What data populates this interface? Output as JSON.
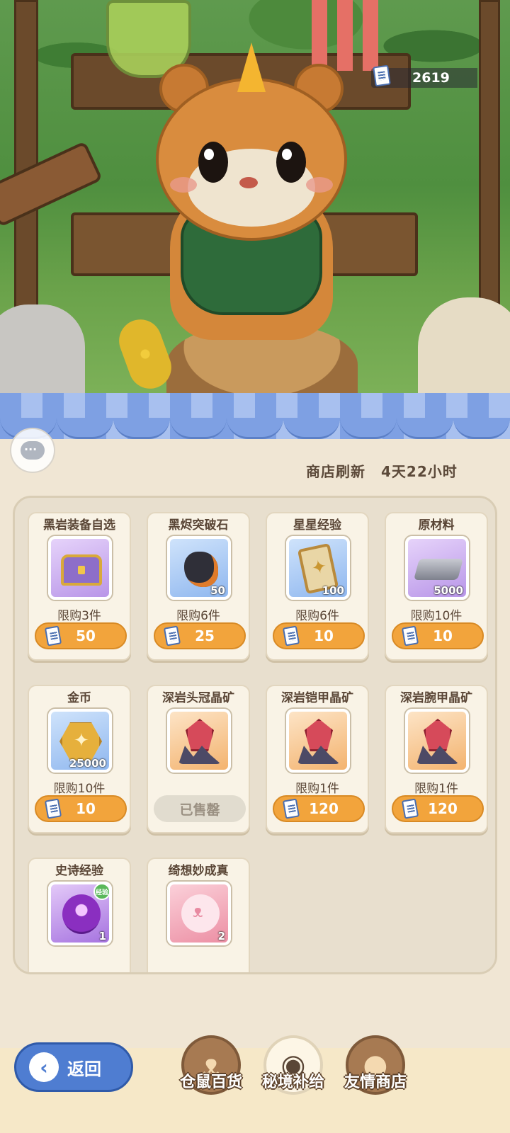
{
  "currency": {
    "icon": "ticket-icon",
    "value": "2619"
  },
  "chat": {
    "icon": "chat-bubble-icon"
  },
  "refresh": {
    "label": "商店刷新",
    "time": "4天22小时"
  },
  "shop_items": [
    {
      "title": "黑岩装备自选",
      "icon": "treasure-chest-icon",
      "bg": "purple",
      "qty": "",
      "limit": "限购3件",
      "price": "50",
      "sold_out": false
    },
    {
      "title": "黑烬突破石",
      "icon": "ember-stone-icon",
      "bg": "blue",
      "qty": "50",
      "limit": "限购6件",
      "price": "25",
      "sold_out": false
    },
    {
      "title": "星星经验",
      "icon": "star-card-icon",
      "bg": "blue",
      "qty": "100",
      "limit": "限购6件",
      "price": "10",
      "sold_out": false
    },
    {
      "title": "原材料",
      "icon": "metal-ingot-icon",
      "bg": "purple",
      "qty": "5000",
      "limit": "限购10件",
      "price": "10",
      "sold_out": false
    },
    {
      "title": "金币",
      "icon": "gold-coin-icon",
      "bg": "blue",
      "qty": "25000",
      "limit": "限购10件",
      "price": "10",
      "sold_out": false
    },
    {
      "title": "深岩头冠晶矿",
      "icon": "helmet-crystal-icon",
      "bg": "orange",
      "qty": "",
      "limit": "",
      "price": "",
      "sold_out": true,
      "sold_out_label": "已售罄"
    },
    {
      "title": "深岩铠甲晶矿",
      "icon": "armor-crystal-icon",
      "bg": "orange",
      "qty": "",
      "limit": "限购1件",
      "price": "120",
      "sold_out": false
    },
    {
      "title": "深岩腕甲晶矿",
      "icon": "bracer-crystal-icon",
      "bg": "orange",
      "qty": "",
      "limit": "限购1件",
      "price": "120",
      "sold_out": false
    },
    {
      "title": "史诗经验",
      "icon": "epic-exp-icon",
      "bg": "violet",
      "qty": "1",
      "badge": "经验",
      "limit": "",
      "price": "",
      "sold_out": false
    },
    {
      "title": "绮想妙成真",
      "icon": "wish-cat-icon",
      "bg": "pink",
      "qty": "2",
      "limit": "",
      "price": "",
      "sold_out": false
    }
  ],
  "back_button": {
    "label": "返回",
    "icon": "back-arrow-icon"
  },
  "tabs": [
    {
      "label": "仓鼠百货",
      "icon": "hamster-icon",
      "active": false
    },
    {
      "label": "秘境补给",
      "icon": "eye-emblem-icon",
      "active": true
    },
    {
      "label": "友情商店",
      "icon": "cookie-globe-icon",
      "active": false
    }
  ],
  "colors": {
    "price_button": "#f2a43c",
    "awning": "#7ea0e3",
    "back_button": "#4f7dd1",
    "panel": "#e8dfce"
  }
}
